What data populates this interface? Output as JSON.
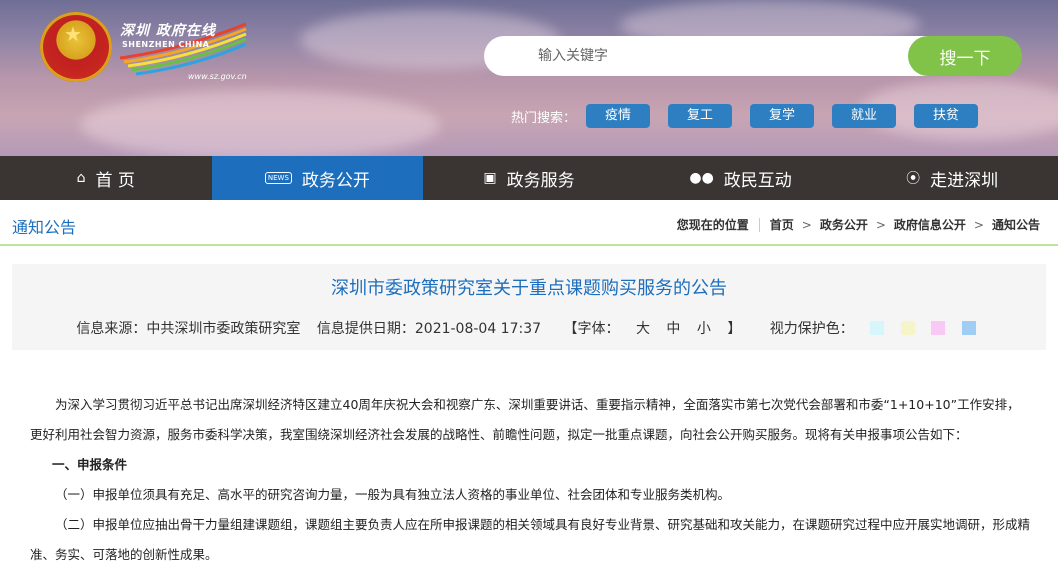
{
  "logo": {
    "cn": "深圳 政府在线",
    "en": "SHENZHEN CHINA",
    "url": "www.sz.gov.cn"
  },
  "search": {
    "placeholder": "输入关键字",
    "button": "搜一下"
  },
  "hot": {
    "label": "热门搜索：",
    "tags": [
      "疫情",
      "复工",
      "复学",
      "就业",
      "扶贫"
    ]
  },
  "nav": [
    {
      "label": "首 页",
      "icon": "home-icon",
      "active": false
    },
    {
      "label": "政务公开",
      "icon": "news-icon",
      "active": true
    },
    {
      "label": "政务服务",
      "icon": "monitor-icon",
      "active": false
    },
    {
      "label": "政民互动",
      "icon": "people-icon",
      "active": false
    },
    {
      "label": "走进深圳",
      "icon": "info-icon",
      "active": false
    }
  ],
  "section_title": "通知公告",
  "breadcrumb": {
    "prefix": "您现在的位置",
    "items": [
      "首页",
      "政务公开",
      "政府信息公开",
      "通知公告"
    ]
  },
  "article": {
    "title": "深圳市委政策研究室关于重点课题购买服务的公告",
    "source": "信息来源：中共深圳市委政策研究室",
    "date": "信息提供日期：2021-08-04 17:37",
    "font_label": "【字体：",
    "font_options": [
      "大",
      "中",
      "小"
    ],
    "font_close": "】",
    "eye_label": "视力保护色：",
    "eye_colors": [
      "#d6f6fb",
      "#f6f4c9",
      "#f8c9f5",
      "#9fcdf3"
    ],
    "paragraphs": [
      "为深入学习贯彻习近平总书记出席深圳经济特区建立40周年庆祝大会和视察广东、深圳重要讲话、重要指示精神，全面落实市第七次党代会部署和市委“1+10+10”工作安排，更好利用社会智力资源，服务市委科学决策，我室围绕深圳经济社会发展的战略性、前瞻性问题，拟定一批重点课题，向社会公开购买服务。现将有关申报事项公告如下：",
      "一、申报条件",
      "（一）申报单位须具有充足、高水平的研究咨询力量，一般为具有独立法人资格的事业单位、社会团体和专业服务类机构。",
      "（二）申报单位应抽出骨干力量组建课题组，课题组主要负责人应在所申报课题的相关领域具有良好专业背景、研究基础和攻关能力，在课题研究过程中应开展实地调研，形成精准、务实、可落地的创新性成果。"
    ]
  },
  "colors": {
    "accent": "#1d6fbd",
    "nav_bg": "#3a3432",
    "search_btn": "#80c348",
    "hot_tag": "#2e7fc1"
  }
}
